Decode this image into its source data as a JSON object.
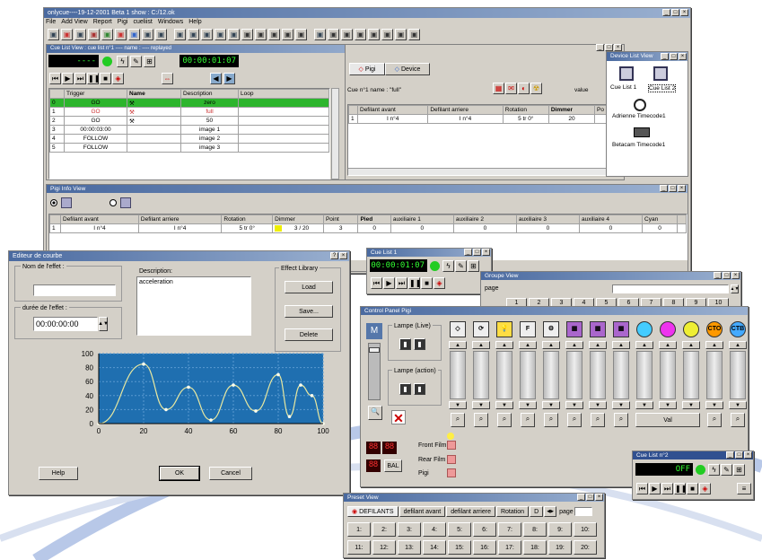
{
  "main": {
    "title": "onlycue----19-12-2001 Beta 1 show : C:/12.ok",
    "menu": [
      "File",
      "Add View",
      "Report",
      "Pigi",
      "cueliist",
      "Windows",
      "Help"
    ]
  },
  "cuelist": {
    "title": "Cue List View : cue list n°1 ---- name : ---- replayed",
    "time": "00:00:01:07",
    "counter": "----",
    "headers": [
      "",
      "Trigger",
      "Name",
      "Description",
      "Loop"
    ],
    "rows": [
      [
        "0",
        "GO",
        "",
        "zero",
        ""
      ],
      [
        "1",
        "GO",
        "",
        "full",
        ""
      ],
      [
        "2",
        "GO",
        "",
        "50",
        ""
      ],
      [
        "3",
        "00:00:03:00",
        "",
        "image 1",
        ""
      ],
      [
        "4",
        "FOLLOW",
        "",
        "image 2",
        ""
      ],
      [
        "5",
        "FOLLOW",
        "",
        "image 3",
        ""
      ]
    ]
  },
  "pigi_tabs": {
    "tab1": "Pigi",
    "tab2": "Device",
    "cue_label": "Cue n°1  name : \"full\"",
    "value_label": "value",
    "headers": [
      "",
      "Defilant avant",
      "Defilant arriere",
      "Rotation",
      "Dimmer",
      "Po"
    ],
    "row": [
      "1",
      "I n°4",
      "I n°4",
      "5 tr 0°",
      "20",
      ""
    ]
  },
  "device": {
    "title": "Device List View",
    "items": [
      "Cue List 1",
      "Cue List 2",
      "Adrienne Timecode1",
      "Betacam Timecode1"
    ]
  },
  "pigiinfo": {
    "title": "Pigi Info View",
    "headers": [
      "",
      "Defilant avant",
      "Defilant arriere",
      "Rotation",
      "Dimmer",
      "Point",
      "Pied",
      "auxiliaire 1",
      "auxiliaire 2",
      "auxiliaire 3",
      "auxiliaire 4",
      "Cyan",
      ""
    ],
    "row": [
      "1",
      "I n°4",
      "I n°4",
      "5 tr 0°",
      "3 / 20",
      "3",
      "0",
      "0",
      "0",
      "0",
      "0",
      "0",
      ""
    ]
  },
  "editeur": {
    "title": "Editeur de courbe",
    "nom_label": "Nom de l'effet :",
    "nom_value": "",
    "duree_label": "durée de l'effet :",
    "duree_value": "00:00:00:00",
    "desc_label": "Description:",
    "desc_value": "acceleration",
    "lib_label": "Effect Library",
    "load": "Load",
    "save": "Save...",
    "delete": "Delete",
    "help": "Help",
    "ok": "OK",
    "cancel": "Cancel",
    "chart_data": {
      "type": "line",
      "x": [
        0,
        20,
        30,
        40,
        50,
        60,
        70,
        80,
        85,
        90,
        95,
        100
      ],
      "values": [
        0,
        85,
        20,
        52,
        5,
        55,
        18,
        70,
        10,
        55,
        40,
        0
      ],
      "ylim": [
        0,
        100
      ],
      "xlim": [
        0,
        100
      ],
      "xticks": [
        "0",
        "20",
        "40",
        "60",
        "80",
        "100"
      ],
      "yticks": [
        "0",
        "20",
        "40",
        "60",
        "80",
        "100"
      ]
    }
  },
  "cuelist1": {
    "title": "Cue List 1",
    "time": "00:00:01:07"
  },
  "groupe": {
    "title": "Groupe View",
    "page_label": "page",
    "pages": [
      "1",
      "2",
      "3",
      "4",
      "5",
      "6",
      "7",
      "8",
      "9",
      "10"
    ]
  },
  "control": {
    "title": "Control Panel Pigi",
    "lampe_live": "Lampe (Live)",
    "lampe_action": "Lampe (action)",
    "front": "Front Film",
    "rear": "Rear Film",
    "pigi": "Pigi",
    "bal": "BAL",
    "val": "Val"
  },
  "cuelist2": {
    "title": "Cue List n°2",
    "display": "OFF"
  },
  "preset": {
    "title": "Preset View",
    "tabs": [
      "DEFILANTS",
      "defilant avant",
      "defilant arriere",
      "Rotation",
      "D"
    ],
    "page_label": "page",
    "row1": [
      "1:",
      "2:",
      "3:",
      "4:",
      "5:",
      "6:",
      "7:",
      "8:",
      "9:",
      "10:"
    ],
    "row2": [
      "11:",
      "12:",
      "13:",
      "14:",
      "15:",
      "16:",
      "17:",
      "18:",
      "19:",
      "20:"
    ]
  }
}
